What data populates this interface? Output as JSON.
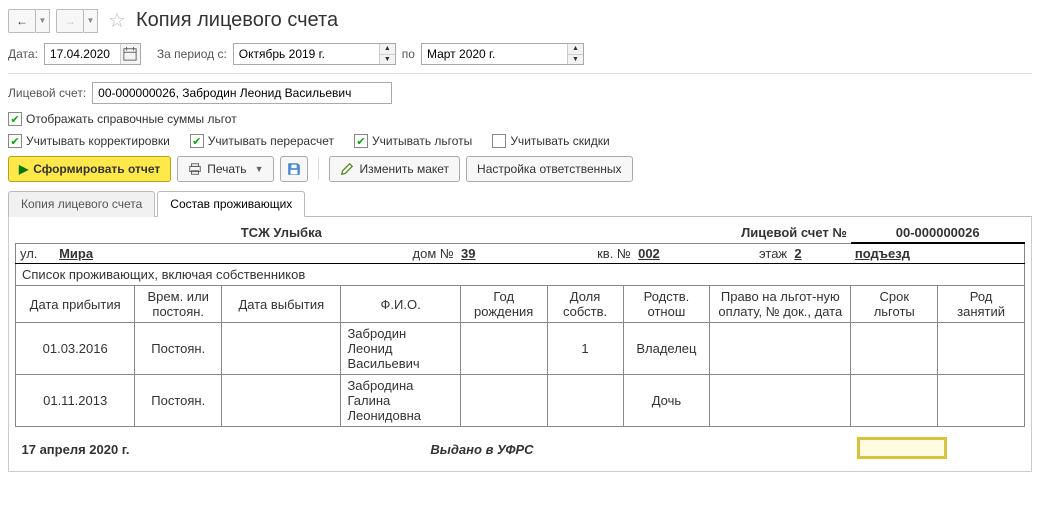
{
  "header": {
    "title": "Копия лицевого счета"
  },
  "fields": {
    "date_label": "Дата:",
    "date_value": "17.04.2020",
    "period_from_label": "За период с:",
    "period_from_value": "Октябрь 2019 г.",
    "period_to_label": "по",
    "period_to_value": "Март 2020 г.",
    "account_label": "Лицевой счет:",
    "account_value": "00-000000026, Забродин Леонид Васильевич"
  },
  "checks": {
    "show_ref_sums": {
      "label": "Отображать справочные суммы льгот",
      "checked": true
    },
    "corr": {
      "label": "Учитывать корректировки",
      "checked": true
    },
    "recalc": {
      "label": "Учитывать перерасчет",
      "checked": true
    },
    "benefits": {
      "label": "Учитывать льготы",
      "checked": true
    },
    "discounts": {
      "label": "Учитывать скидки",
      "checked": false
    }
  },
  "actions": {
    "generate": "Сформировать отчет",
    "print": "Печать",
    "edit_layout": "Изменить макет",
    "responsible": "Настройка ответственных"
  },
  "tabs": [
    {
      "id": "copy",
      "label": "Копия лицевого счета",
      "active": false
    },
    {
      "id": "residents",
      "label": "Состав проживающих",
      "active": true
    }
  ],
  "report": {
    "org_name": "ТСЖ Улыбка",
    "account_title": "Лицевой счет  №",
    "account_no": "00-000000026",
    "address": {
      "street_lbl": "ул.",
      "street_val": "Мира",
      "house_lbl": "дом №",
      "house_val": "39",
      "apt_lbl": "кв. №",
      "apt_val": "002",
      "floor_lbl": "этаж",
      "floor_val": "2",
      "entrance_lbl": "подъезд",
      "entrance_val": ""
    },
    "list_title": "Список проживающих, включая собственников",
    "columns": [
      "Дата прибытия",
      "Врем. или постоян.",
      "Дата выбытия",
      "Ф.И.О.",
      "Год рождения",
      "Доля собств.",
      "Родств. отнош",
      "Право на льгот-ную оплату, № док., дата",
      "Срок льготы",
      "Род занятий"
    ],
    "rows": [
      {
        "arrival": "01.03.2016",
        "type": "Постоян.",
        "departure": "",
        "fio": "Забродин Леонид Васильевич",
        "birth": "",
        "share": "1",
        "relation": "Владелец",
        "benefit": "",
        "term": "",
        "occ": ""
      },
      {
        "arrival": "01.11.2013",
        "type": "Постоян.",
        "departure": "",
        "fio": "Забродина Галина Леонидовна",
        "birth": "",
        "share": "",
        "relation": "Дочь",
        "benefit": "",
        "term": "",
        "occ": ""
      }
    ],
    "footer_date": "17 апреля 2020 г.",
    "footer_issued": "Выдано в УФРС"
  }
}
